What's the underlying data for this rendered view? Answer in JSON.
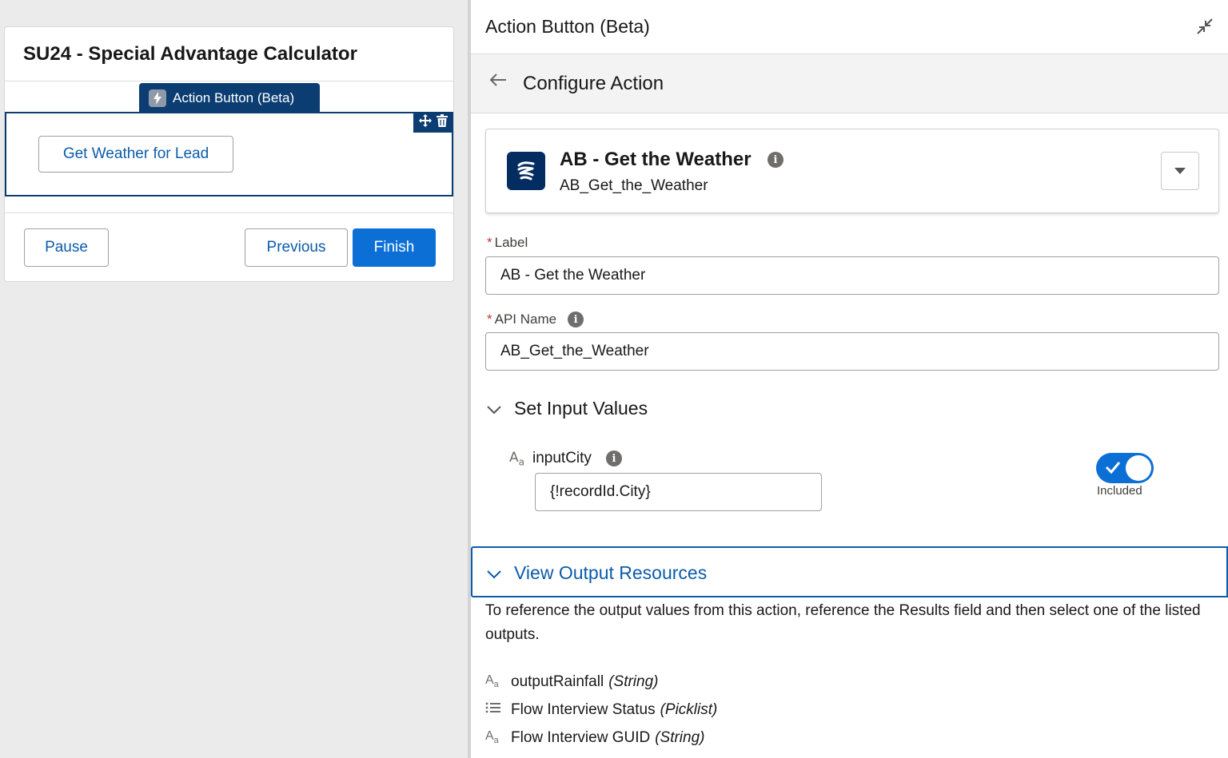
{
  "canvas": {
    "screen_title": "SU24 - Special Advantage Calculator",
    "component_tag": "Action Button (Beta)",
    "action_button_label": "Get Weather for Lead",
    "footer": {
      "pause_label": "Pause",
      "previous_label": "Previous",
      "finish_label": "Finish"
    }
  },
  "panel": {
    "title": "Action Button (Beta)",
    "configure_title": "Configure Action",
    "action": {
      "name": "AB - Get the Weather",
      "api_name": "AB_Get_the_Weather"
    },
    "label_field": {
      "label": "Label",
      "value": "AB - Get the Weather"
    },
    "api_name_field": {
      "label": "API Name",
      "value": "AB_Get_the_Weather"
    },
    "input_section": {
      "title": "Set Input Values",
      "input_name": "inputCity",
      "input_value": "{!recordId.City}",
      "toggle_label": "Included",
      "included": true
    },
    "output_section": {
      "title": "View Output Resources",
      "description": "To reference the output values from this action, reference the Results field and then select one of the listed outputs.",
      "items": [
        {
          "name": "outputRainfall",
          "type": "(String)",
          "icon": "text-type-icon"
        },
        {
          "name": "Flow Interview Status",
          "type": "(Picklist)",
          "icon": "list-icon"
        },
        {
          "name": "Flow Interview GUID",
          "type": "(String)",
          "icon": "text-type-icon"
        }
      ]
    }
  },
  "colors": {
    "brand_blue": "#0b6fd6",
    "link_blue": "#0b5cab",
    "selection_navy": "#0b3d72",
    "action_icon_bg": "#032d60"
  }
}
